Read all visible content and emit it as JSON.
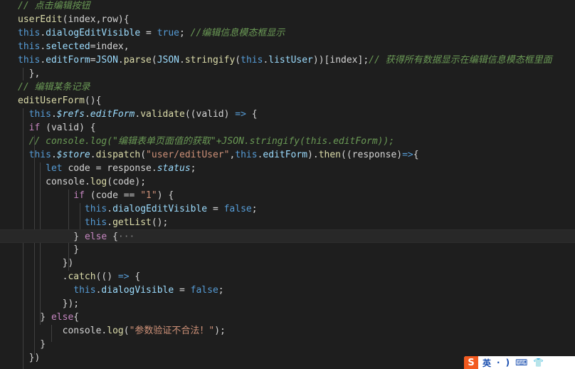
{
  "lines": [
    [
      {
        "t": "// 点击编辑按钮",
        "c": "cmt"
      }
    ],
    [
      {
        "t": "userEdit",
        "c": "fn"
      },
      {
        "t": "(index,row){",
        "c": "plain"
      }
    ],
    [
      {
        "t": "this",
        "c": "kw-this"
      },
      {
        "t": ".",
        "c": "plain"
      },
      {
        "t": "dialogEditVisible",
        "c": "prop"
      },
      {
        "t": " = ",
        "c": "plain"
      },
      {
        "t": "true",
        "c": "bool"
      },
      {
        "t": "; ",
        "c": "plain"
      },
      {
        "t": "//编辑信息模态框显示",
        "c": "cmt"
      }
    ],
    [
      {
        "t": "this",
        "c": "kw-this"
      },
      {
        "t": ".",
        "c": "plain"
      },
      {
        "t": "selected",
        "c": "prop"
      },
      {
        "t": "=index,",
        "c": "plain"
      }
    ],
    [
      {
        "t": "this",
        "c": "kw-this"
      },
      {
        "t": ".",
        "c": "plain"
      },
      {
        "t": "editForm",
        "c": "prop"
      },
      {
        "t": "=",
        "c": "plain"
      },
      {
        "t": "JSON",
        "c": "prop"
      },
      {
        "t": ".",
        "c": "plain"
      },
      {
        "t": "parse",
        "c": "fn"
      },
      {
        "t": "(",
        "c": "plain"
      },
      {
        "t": "JSON",
        "c": "prop"
      },
      {
        "t": ".",
        "c": "plain"
      },
      {
        "t": "stringify",
        "c": "fn"
      },
      {
        "t": "(",
        "c": "plain"
      },
      {
        "t": "this",
        "c": "kw-this"
      },
      {
        "t": ".",
        "c": "plain"
      },
      {
        "t": "listUser",
        "c": "prop"
      },
      {
        "t": "))[index];",
        "c": "plain"
      },
      {
        "t": "// 获得所有数据显示在编辑信息模态框里面",
        "c": "cmt"
      }
    ],
    [
      {
        "t": "  },",
        "c": "plain"
      }
    ],
    [
      {
        "t": "// 编辑某条记录",
        "c": "cmt"
      }
    ],
    [
      {
        "t": "editUserForm",
        "c": "fn"
      },
      {
        "t": "(){",
        "c": "plain"
      }
    ],
    [
      {
        "t": "  ",
        "c": "plain"
      },
      {
        "t": "this",
        "c": "kw-this"
      },
      {
        "t": ".",
        "c": "plain"
      },
      {
        "t": "$refs",
        "c": "store"
      },
      {
        "t": ".",
        "c": "plain"
      },
      {
        "t": "editForm",
        "c": "store"
      },
      {
        "t": ".",
        "c": "plain"
      },
      {
        "t": "validate",
        "c": "fn"
      },
      {
        "t": "((valid) ",
        "c": "plain"
      },
      {
        "t": "=>",
        "c": "kw-this"
      },
      {
        "t": " {",
        "c": "plain"
      }
    ],
    [
      {
        "t": "  ",
        "c": "plain"
      },
      {
        "t": "if",
        "c": "kw"
      },
      {
        "t": " (valid) {",
        "c": "plain"
      }
    ],
    [
      {
        "t": "  ",
        "c": "plain"
      },
      {
        "t": "// console.log(\"编辑表单页面值的获取\"+JSON.stringify(this.editForm));",
        "c": "cmt"
      }
    ],
    [
      {
        "t": "  ",
        "c": "plain"
      },
      {
        "t": "this",
        "c": "kw-this"
      },
      {
        "t": ".",
        "c": "plain"
      },
      {
        "t": "$store",
        "c": "store"
      },
      {
        "t": ".",
        "c": "plain"
      },
      {
        "t": "dispatch",
        "c": "fn"
      },
      {
        "t": "(",
        "c": "plain"
      },
      {
        "t": "\"user/editUser\"",
        "c": "str"
      },
      {
        "t": ",",
        "c": "plain"
      },
      {
        "t": "this",
        "c": "kw-this"
      },
      {
        "t": ".",
        "c": "plain"
      },
      {
        "t": "editForm",
        "c": "prop"
      },
      {
        "t": ").",
        "c": "plain"
      },
      {
        "t": "then",
        "c": "fn"
      },
      {
        "t": "((response)",
        "c": "plain"
      },
      {
        "t": "=>",
        "c": "kw-this"
      },
      {
        "t": "{",
        "c": "plain"
      }
    ],
    [
      {
        "t": "     ",
        "c": "plain"
      },
      {
        "t": "let",
        "c": "kw-this"
      },
      {
        "t": " code = response.",
        "c": "plain"
      },
      {
        "t": "status",
        "c": "store"
      },
      {
        "t": ";",
        "c": "plain"
      }
    ],
    [
      {
        "t": "     ",
        "c": "plain"
      },
      {
        "t": "console",
        "c": "plain"
      },
      {
        "t": ".",
        "c": "plain"
      },
      {
        "t": "log",
        "c": "fn"
      },
      {
        "t": "(code);",
        "c": "plain"
      }
    ],
    [
      {
        "t": "          ",
        "c": "plain"
      },
      {
        "t": "if",
        "c": "kw"
      },
      {
        "t": " (code == ",
        "c": "plain"
      },
      {
        "t": "\"1\"",
        "c": "str"
      },
      {
        "t": ") {",
        "c": "plain"
      }
    ],
    [
      {
        "t": "            ",
        "c": "plain"
      },
      {
        "t": "this",
        "c": "kw-this"
      },
      {
        "t": ".",
        "c": "plain"
      },
      {
        "t": "dialogEditVisible",
        "c": "prop"
      },
      {
        "t": " = ",
        "c": "plain"
      },
      {
        "t": "false",
        "c": "bool"
      },
      {
        "t": ";",
        "c": "plain"
      }
    ],
    [
      {
        "t": "            ",
        "c": "plain"
      },
      {
        "t": "this",
        "c": "kw-this"
      },
      {
        "t": ".",
        "c": "plain"
      },
      {
        "t": "getList",
        "c": "fn"
      },
      {
        "t": "();",
        "c": "plain"
      }
    ],
    [
      {
        "t": "          ",
        "c": "plain"
      },
      {
        "t": "} ",
        "c": "plain"
      },
      {
        "t": "else",
        "c": "kw"
      },
      {
        "t": " {",
        "c": "plain"
      },
      {
        "t": "···",
        "c": "fold"
      }
    ],
    [
      {
        "t": "          }",
        "c": "plain"
      }
    ],
    [
      {
        "t": "        })",
        "c": "plain"
      }
    ],
    [
      {
        "t": "        .",
        "c": "plain"
      },
      {
        "t": "catch",
        "c": "fn"
      },
      {
        "t": "(() ",
        "c": "plain"
      },
      {
        "t": "=>",
        "c": "kw-this"
      },
      {
        "t": " {",
        "c": "plain"
      }
    ],
    [
      {
        "t": "          ",
        "c": "plain"
      },
      {
        "t": "this",
        "c": "kw-this"
      },
      {
        "t": ".",
        "c": "plain"
      },
      {
        "t": "dialogVisible",
        "c": "prop"
      },
      {
        "t": " = ",
        "c": "plain"
      },
      {
        "t": "false",
        "c": "bool"
      },
      {
        "t": ";",
        "c": "plain"
      }
    ],
    [
      {
        "t": "        });",
        "c": "plain"
      }
    ],
    [
      {
        "t": "    } ",
        "c": "plain"
      },
      {
        "t": "else",
        "c": "kw"
      },
      {
        "t": "{",
        "c": "plain"
      }
    ],
    [
      {
        "t": "        ",
        "c": "plain"
      },
      {
        "t": "console",
        "c": "plain"
      },
      {
        "t": ".",
        "c": "plain"
      },
      {
        "t": "log",
        "c": "fn"
      },
      {
        "t": "(",
        "c": "plain"
      },
      {
        "t": "\"参数验证不合法！\"",
        "c": "str"
      },
      {
        "t": ");",
        "c": "plain"
      }
    ],
    [
      {
        "t": "    }",
        "c": "plain"
      }
    ],
    [
      {
        "t": "  })",
        "c": "plain"
      }
    ]
  ],
  "current_line_index": 17,
  "ime": {
    "logo": "S",
    "mode": "英",
    "items": [
      "·",
      ")",
      "⌨",
      "👕"
    ]
  }
}
